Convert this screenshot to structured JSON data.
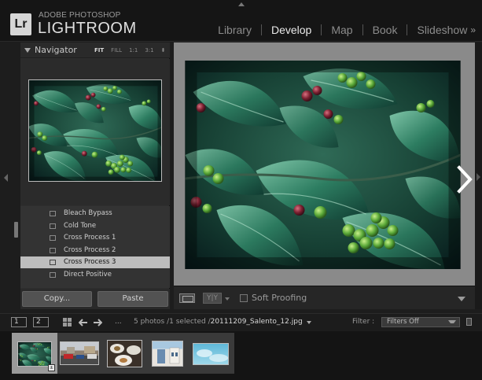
{
  "app": {
    "logo_text": "Lr",
    "brand_small": "ADOBE PHOTOSHOP",
    "brand_big": "LIGHTROOM"
  },
  "modules": [
    {
      "label": "Library",
      "active": false
    },
    {
      "label": "Develop",
      "active": true
    },
    {
      "label": "Map",
      "active": false
    },
    {
      "label": "Book",
      "active": false
    },
    {
      "label": "Slideshow",
      "active": false
    }
  ],
  "modules_more": "»",
  "navigator": {
    "title": "Navigator",
    "zoom_options": [
      "FIT",
      "FILL",
      "1:1",
      "3:1"
    ],
    "zoom_selected": "FIT",
    "zoom_caret": "⬍"
  },
  "presets": [
    {
      "label": "Bleach Bypass",
      "selected": false
    },
    {
      "label": "Cold Tone",
      "selected": false
    },
    {
      "label": "Cross Process 1",
      "selected": false
    },
    {
      "label": "Cross Process 2",
      "selected": false
    },
    {
      "label": "Cross Process 3",
      "selected": true
    },
    {
      "label": "Direct Positive",
      "selected": false
    }
  ],
  "buttons": {
    "copy_label": "Copy...",
    "paste_label": "Paste"
  },
  "toolbar": {
    "compare_label": "Y|Y",
    "soft_proofing_label": "Soft Proofing",
    "soft_proofing_checked": false
  },
  "filmstrip_bar": {
    "monitor_1": "1",
    "monitor_2": "2",
    "ellipsis": "...",
    "info_prefix": "5 photos /1 selected /",
    "filename": "20111209_Salento_12.jpg",
    "filter_label": "Filter :",
    "filter_value": "Filters Off"
  },
  "filmstrip": [
    {
      "name": "coffee-plant",
      "selected": true
    },
    {
      "name": "street-cars",
      "selected": false
    },
    {
      "name": "plates-table",
      "selected": false
    },
    {
      "name": "building-street",
      "selected": false
    },
    {
      "name": "sky-clouds",
      "selected": false
    }
  ],
  "colors": {
    "photo_dark": "#0d2a22",
    "photo_leaf": "#2e7a5c",
    "photo_berry_green": "#5fae3c",
    "photo_berry_red": "#7a2030",
    "panel_bg": "#2e2e2e",
    "preset_selected": "#bdbdbd"
  },
  "icons": {
    "next_photo": "chevron-right-icon",
    "prev_nav": "arrow-left-icon",
    "next_nav": "arrow-right-icon",
    "grid": "grid-icon",
    "lock": "lock-icon"
  }
}
